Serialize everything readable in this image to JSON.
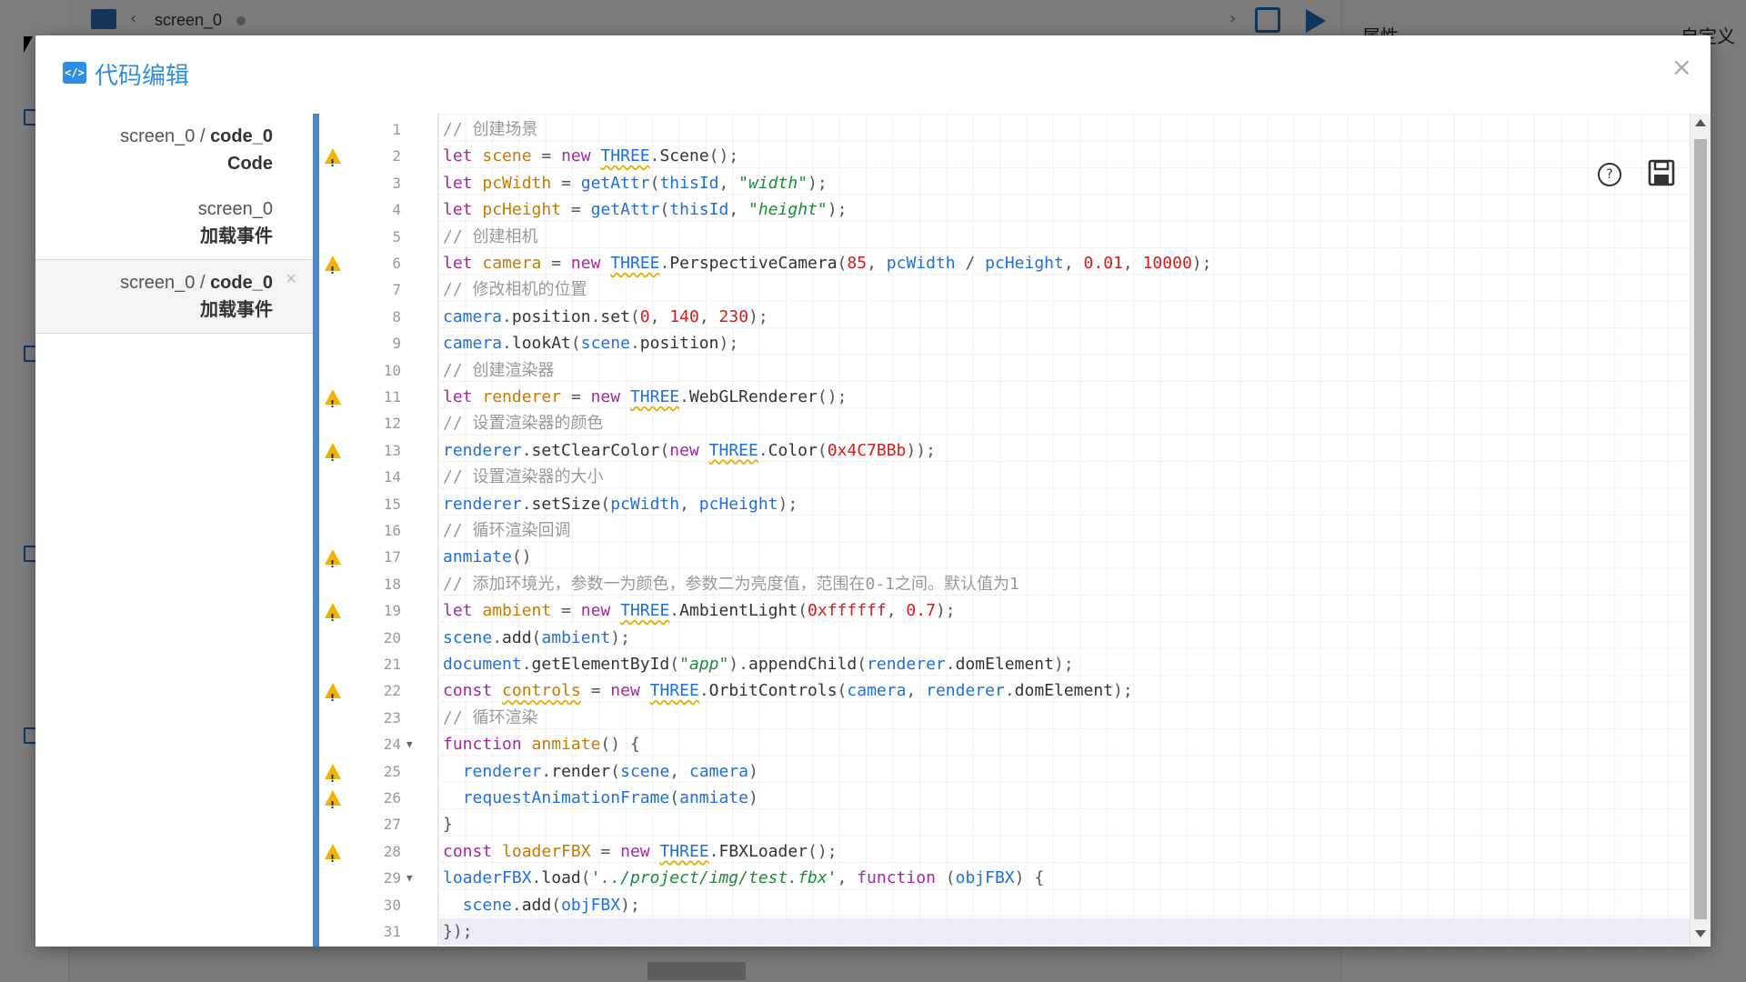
{
  "background": {
    "tab_label": "screen_0",
    "right_panel_title": "属性",
    "right_panel_custom": "自定义"
  },
  "modal": {
    "title": "代码编辑",
    "icon": "code-icon",
    "close_label": "×"
  },
  "sidebar": {
    "items": [
      {
        "path": "screen_0 / ",
        "name": "code_0",
        "sub": "Code",
        "active": false
      },
      {
        "path": "screen_0",
        "name": "",
        "sub": "加载事件",
        "active": false
      },
      {
        "path": "screen_0 / ",
        "name": "code_0",
        "sub": "加载事件",
        "active": true,
        "close": "×"
      }
    ]
  },
  "editor": {
    "toolbar": {
      "help_label": "?",
      "help_icon": "help-icon",
      "save_icon": "save-icon"
    },
    "active_line": 31,
    "warning_lines": [
      2,
      6,
      11,
      13,
      17,
      19,
      22,
      25,
      26,
      28
    ],
    "fold_lines": [
      24,
      29
    ],
    "lines": [
      "// 创建场景",
      "let scene = new THREE.Scene();",
      "let pcWidth = getAttr(thisId, \"width\");",
      "let pcHeight = getAttr(thisId, \"height\");",
      "// 创建相机",
      "let camera = new THREE.PerspectiveCamera(85, pcWidth / pcHeight, 0.01, 10000);",
      "// 修改相机的位置",
      "camera.position.set(0, 140, 230);",
      "camera.lookAt(scene.position);",
      "// 创建渲染器",
      "let renderer = new THREE.WebGLRenderer();",
      "// 设置渲染器的颜色",
      "renderer.setClearColor(new THREE.Color(0x4C7BBb));",
      "// 设置渲染器的大小",
      "renderer.setSize(pcWidth, pcHeight);",
      "// 循环渲染回调",
      "anmiate()",
      "// 添加环境光，参数一为颜色，参数二为亮度值，范围在0-1之间。默认值为1",
      "let ambient = new THREE.AmbientLight(0xffffff, 0.7);",
      "scene.add(ambient);",
      "document.getElementById(\"app\").appendChild(renderer.domElement);",
      "const controls = new THREE.OrbitControls(camera, renderer.domElement);",
      "// 循环渲染",
      "function anmiate() {",
      "  renderer.render(scene, camera)",
      "  requestAnimationFrame(anmiate)",
      "}",
      "const loaderFBX = new THREE.FBXLoader();",
      "loaderFBX.load('../project/img/test.fbx', function (objFBX) {",
      "  scene.add(objFBX);",
      "});"
    ]
  },
  "colors": {
    "accent": "#2e8de6",
    "divider": "#4a86c8",
    "warning": "#f0b400"
  }
}
